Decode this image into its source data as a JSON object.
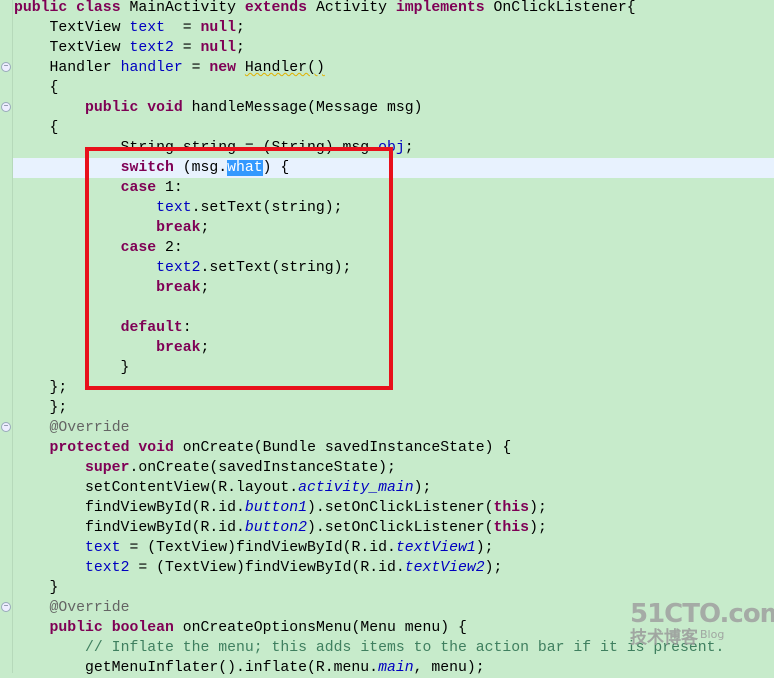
{
  "colors": {
    "background": "#c7ebcb",
    "keyword": "#7f0055",
    "field": "#0000c0",
    "annotation": "#646464",
    "comment": "#3f7f5f",
    "current_line": "#e8f2fe",
    "selection": "#3399ff",
    "annotation_box": "#e8101b"
  },
  "gutter": {
    "fold_icon": "fold-collapse-icon",
    "fold_lines": [
      3,
      5,
      21,
      30
    ]
  },
  "current_line": 8,
  "lines": [
    [
      [
        "public",
        "kw"
      ],
      [
        " ",
        ""
      ],
      [
        "class",
        "kw"
      ],
      [
        " MainActivity ",
        ""
      ],
      [
        "extends",
        "kw"
      ],
      [
        " Activity ",
        ""
      ],
      [
        "implements",
        "kw"
      ],
      [
        " OnClickListener{",
        ""
      ]
    ],
    [
      [
        "    TextView ",
        ""
      ],
      [
        "text",
        "field"
      ],
      [
        "  = ",
        ""
      ],
      [
        "null",
        "kw"
      ],
      [
        ";",
        ""
      ]
    ],
    [
      [
        "    TextView ",
        ""
      ],
      [
        "text2",
        "field"
      ],
      [
        " = ",
        ""
      ],
      [
        "null",
        "kw"
      ],
      [
        ";",
        ""
      ]
    ],
    [
      [
        "    Handler ",
        ""
      ],
      [
        "handler",
        "field"
      ],
      [
        " = ",
        ""
      ],
      [
        "new",
        "kw"
      ],
      [
        " ",
        ""
      ],
      [
        "Handler()",
        "warn"
      ]
    ],
    [
      [
        "    {",
        ""
      ]
    ],
    [
      [
        "        ",
        ""
      ],
      [
        "public",
        "kw"
      ],
      [
        " ",
        ""
      ],
      [
        "void",
        "kw"
      ],
      [
        " handleMessage(Message msg)",
        ""
      ]
    ],
    [
      [
        "    {",
        ""
      ]
    ],
    [
      [
        "            String string = (String) msg.",
        ""
      ],
      [
        "obj",
        "field"
      ],
      [
        ";",
        ""
      ]
    ],
    [
      [
        "            ",
        ""
      ],
      [
        "switch",
        "kw"
      ],
      [
        " (msg.",
        ""
      ],
      [
        "what",
        "sel"
      ],
      [
        ") {",
        ""
      ]
    ],
    [
      [
        "            ",
        ""
      ],
      [
        "case",
        "kw"
      ],
      [
        " 1:",
        ""
      ]
    ],
    [
      [
        "                ",
        ""
      ],
      [
        "text",
        "field"
      ],
      [
        ".setText(string);",
        ""
      ]
    ],
    [
      [
        "                ",
        ""
      ],
      [
        "break",
        "kw"
      ],
      [
        ";",
        ""
      ]
    ],
    [
      [
        "            ",
        ""
      ],
      [
        "case",
        "kw"
      ],
      [
        " 2:",
        ""
      ]
    ],
    [
      [
        "                ",
        ""
      ],
      [
        "text2",
        "field"
      ],
      [
        ".setText(string);",
        ""
      ]
    ],
    [
      [
        "                ",
        ""
      ],
      [
        "break",
        "kw"
      ],
      [
        ";",
        ""
      ]
    ],
    [],
    [
      [
        "            ",
        ""
      ],
      [
        "default",
        "kw"
      ],
      [
        ":",
        ""
      ]
    ],
    [
      [
        "                ",
        ""
      ],
      [
        "break",
        "kw"
      ],
      [
        ";",
        ""
      ]
    ],
    [
      [
        "            }",
        ""
      ]
    ],
    [
      [
        "    };",
        ""
      ]
    ],
    [
      [
        "    };",
        ""
      ]
    ],
    [
      [
        "    ",
        ""
      ],
      [
        "@Override",
        "ann"
      ]
    ],
    [
      [
        "    ",
        ""
      ],
      [
        "protected",
        "kw"
      ],
      [
        " ",
        ""
      ],
      [
        "void",
        "kw"
      ],
      [
        " onCreate(Bundle savedInstanceState) {",
        ""
      ]
    ],
    [
      [
        "        ",
        ""
      ],
      [
        "super",
        "kw"
      ],
      [
        ".onCreate(savedInstanceState);",
        ""
      ]
    ],
    [
      [
        "        setContentView(R.layout.",
        ""
      ],
      [
        "activity_main",
        "static"
      ],
      [
        ");",
        ""
      ]
    ],
    [
      [
        "        findViewById(R.id.",
        ""
      ],
      [
        "button1",
        "static"
      ],
      [
        ").setOnClickListener(",
        ""
      ],
      [
        "this",
        "kw"
      ],
      [
        ");",
        ""
      ]
    ],
    [
      [
        "        findViewById(R.id.",
        ""
      ],
      [
        "button2",
        "static"
      ],
      [
        ").setOnClickListener(",
        ""
      ],
      [
        "this",
        "kw"
      ],
      [
        ");",
        ""
      ]
    ],
    [
      [
        "        ",
        ""
      ],
      [
        "text",
        "field"
      ],
      [
        " = (TextView)findViewById(R.id.",
        ""
      ],
      [
        "textView1",
        "static"
      ],
      [
        ");",
        ""
      ]
    ],
    [
      [
        "        ",
        ""
      ],
      [
        "text2",
        "field"
      ],
      [
        " = (TextView)findViewById(R.id.",
        ""
      ],
      [
        "textView2",
        "static"
      ],
      [
        ");",
        ""
      ]
    ],
    [
      [
        "    }",
        ""
      ]
    ],
    [
      [
        "    ",
        ""
      ],
      [
        "@Override",
        "ann"
      ]
    ],
    [
      [
        "    ",
        ""
      ],
      [
        "public",
        "kw"
      ],
      [
        " ",
        ""
      ],
      [
        "boolean",
        "kw"
      ],
      [
        " onCreateOptionsMenu(Menu menu) {",
        ""
      ]
    ],
    [
      [
        "        ",
        ""
      ],
      [
        "// Inflate the menu; this adds items to the action bar if it is present.",
        "comment"
      ]
    ],
    [
      [
        "        getMenuInflater().inflate(R.menu.",
        ""
      ],
      [
        "main",
        "static"
      ],
      [
        ", menu);",
        ""
      ]
    ]
  ],
  "watermark": {
    "main": "51CTO.com",
    "sub": "技术博客",
    "blog": "Blog"
  }
}
